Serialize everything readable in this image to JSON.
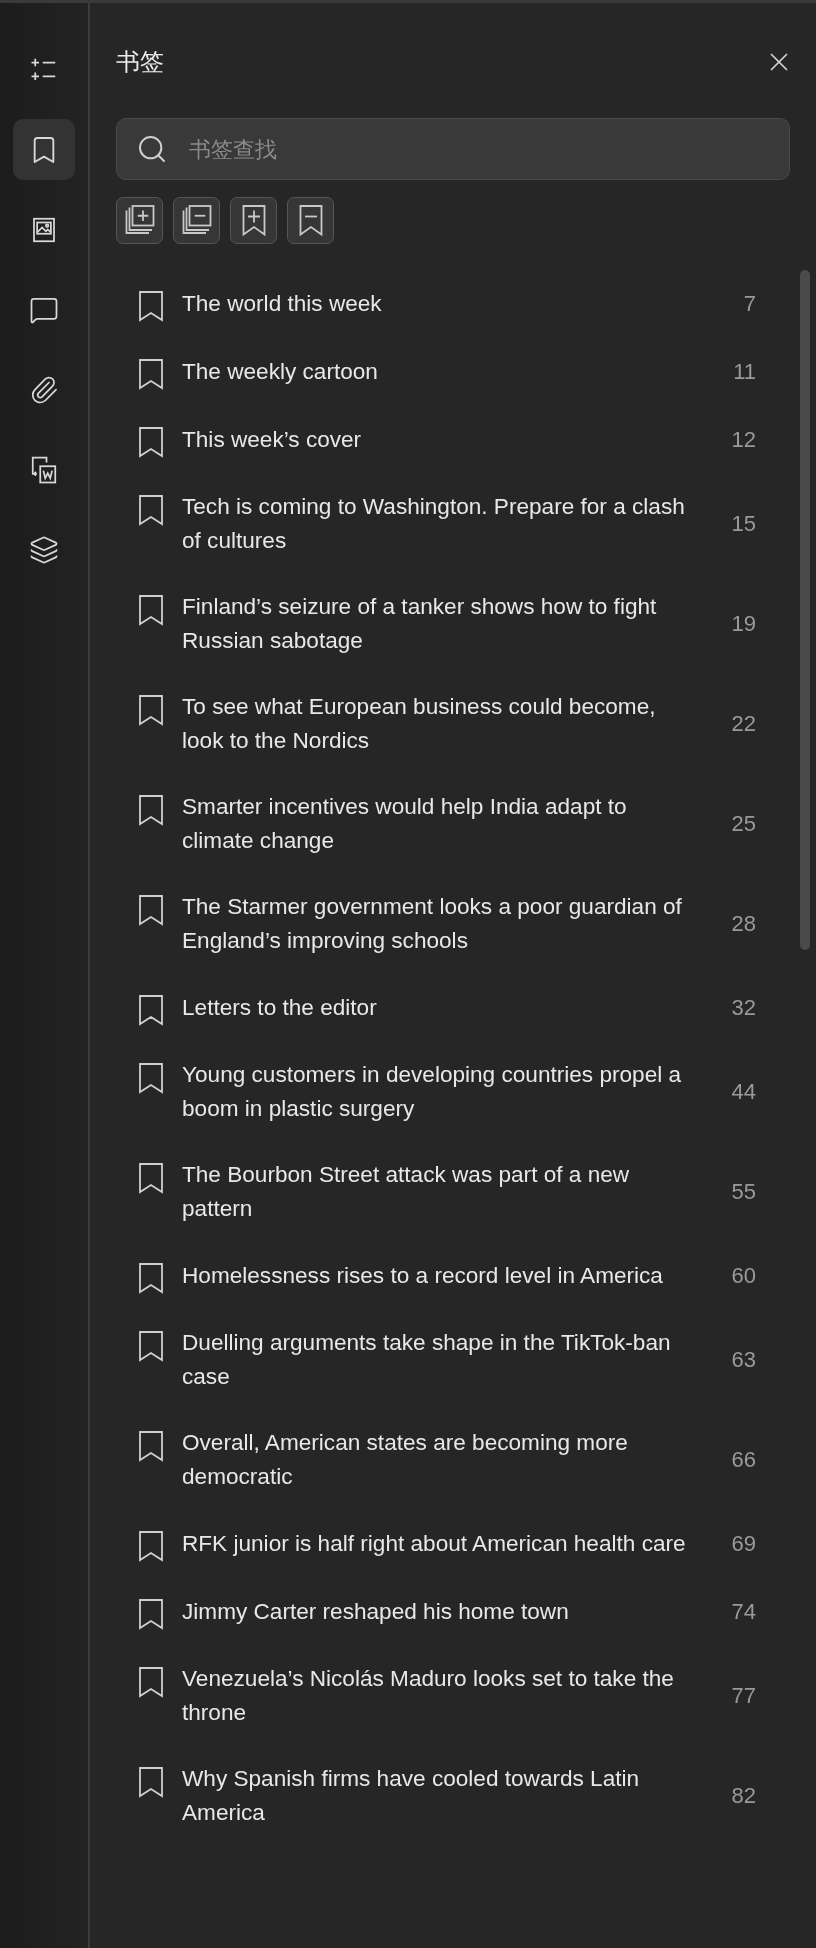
{
  "sidebar": {
    "items": [
      {
        "kind": "outline",
        "selected": false
      },
      {
        "kind": "bookmarks",
        "selected": true
      },
      {
        "kind": "images",
        "selected": false
      },
      {
        "kind": "comments",
        "selected": false
      },
      {
        "kind": "attachments",
        "selected": false
      },
      {
        "kind": "convert",
        "selected": false
      },
      {
        "kind": "layers",
        "selected": false
      }
    ]
  },
  "panel": {
    "title": "书签",
    "search": {
      "placeholder": "书签查找"
    },
    "tools": [
      {
        "kind": "expand"
      },
      {
        "kind": "collapse"
      },
      {
        "kind": "add"
      },
      {
        "kind": "remove"
      }
    ],
    "bookmarks": [
      {
        "title": "The world this week",
        "page": "7"
      },
      {
        "title": "The weekly cartoon",
        "page": "11"
      },
      {
        "title": "This week’s cover",
        "page": "12"
      },
      {
        "title": "Tech is coming to Washington. Prepare for a clash of cultures",
        "page": "15"
      },
      {
        "title": "Finland’s seizure of a tanker shows how to fight Russian sabotage",
        "page": "19"
      },
      {
        "title": "To see what European business could become, look to the Nordics",
        "page": "22"
      },
      {
        "title": "Smarter incentives would help India adapt to climate change",
        "page": "25"
      },
      {
        "title": "The Starmer government looks a poor guardian of England’s improving schools",
        "page": "28"
      },
      {
        "title": "Letters to the editor",
        "page": "32"
      },
      {
        "title": "Young customers in developing countries propel a boom in plastic surgery",
        "page": "44"
      },
      {
        "title": "The Bourbon Street attack was part of a new pattern",
        "page": "55"
      },
      {
        "title": "Homelessness rises to a record level in America",
        "page": "60"
      },
      {
        "title": "Duelling arguments take shape in the TikTok-ban case",
        "page": "63"
      },
      {
        "title": "Overall, American states are becoming more democratic",
        "page": "66"
      },
      {
        "title": "RFK junior is half right about American health care",
        "page": "69"
      },
      {
        "title": "Jimmy Carter reshaped his home town",
        "page": "74"
      },
      {
        "title": "Venezuela’s Nicolás Maduro looks set to take the throne",
        "page": "77"
      },
      {
        "title": "Why Spanish firms have cooled towards Latin America",
        "page": "82"
      }
    ]
  }
}
